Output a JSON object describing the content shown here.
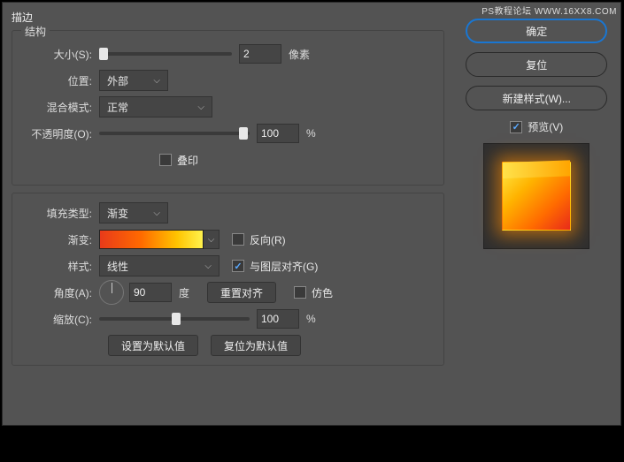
{
  "watermark": "PS教程论坛 WWW.16XX8.COM",
  "title": "描边",
  "structure": {
    "group_title": "结构",
    "size_label": "大小(S):",
    "size_value": "2",
    "size_unit": "像素",
    "position_label": "位置:",
    "position_value": "外部",
    "blend_label": "混合模式:",
    "blend_value": "正常",
    "opacity_label": "不透明度(O):",
    "opacity_value": "100",
    "opacity_unit": "%",
    "overprint_label": "叠印"
  },
  "fill": {
    "filltype_label": "填充类型:",
    "filltype_value": "渐变",
    "gradient_label": "渐变:",
    "reverse_label": "反向(R)",
    "style_label": "样式:",
    "style_value": "线性",
    "align_label": "与图层对齐(G)",
    "angle_label": "角度(A):",
    "angle_value": "90",
    "angle_unit": "度",
    "reset_align": "重置对齐",
    "dither_label": "仿色",
    "scale_label": "缩放(C):",
    "scale_value": "100",
    "scale_unit": "%"
  },
  "buttons": {
    "set_default": "设置为默认值",
    "reset_default": "复位为默认值",
    "ok": "确定",
    "cancel": "复位",
    "new_style": "新建样式(W)...",
    "preview_label": "预览(V)"
  }
}
